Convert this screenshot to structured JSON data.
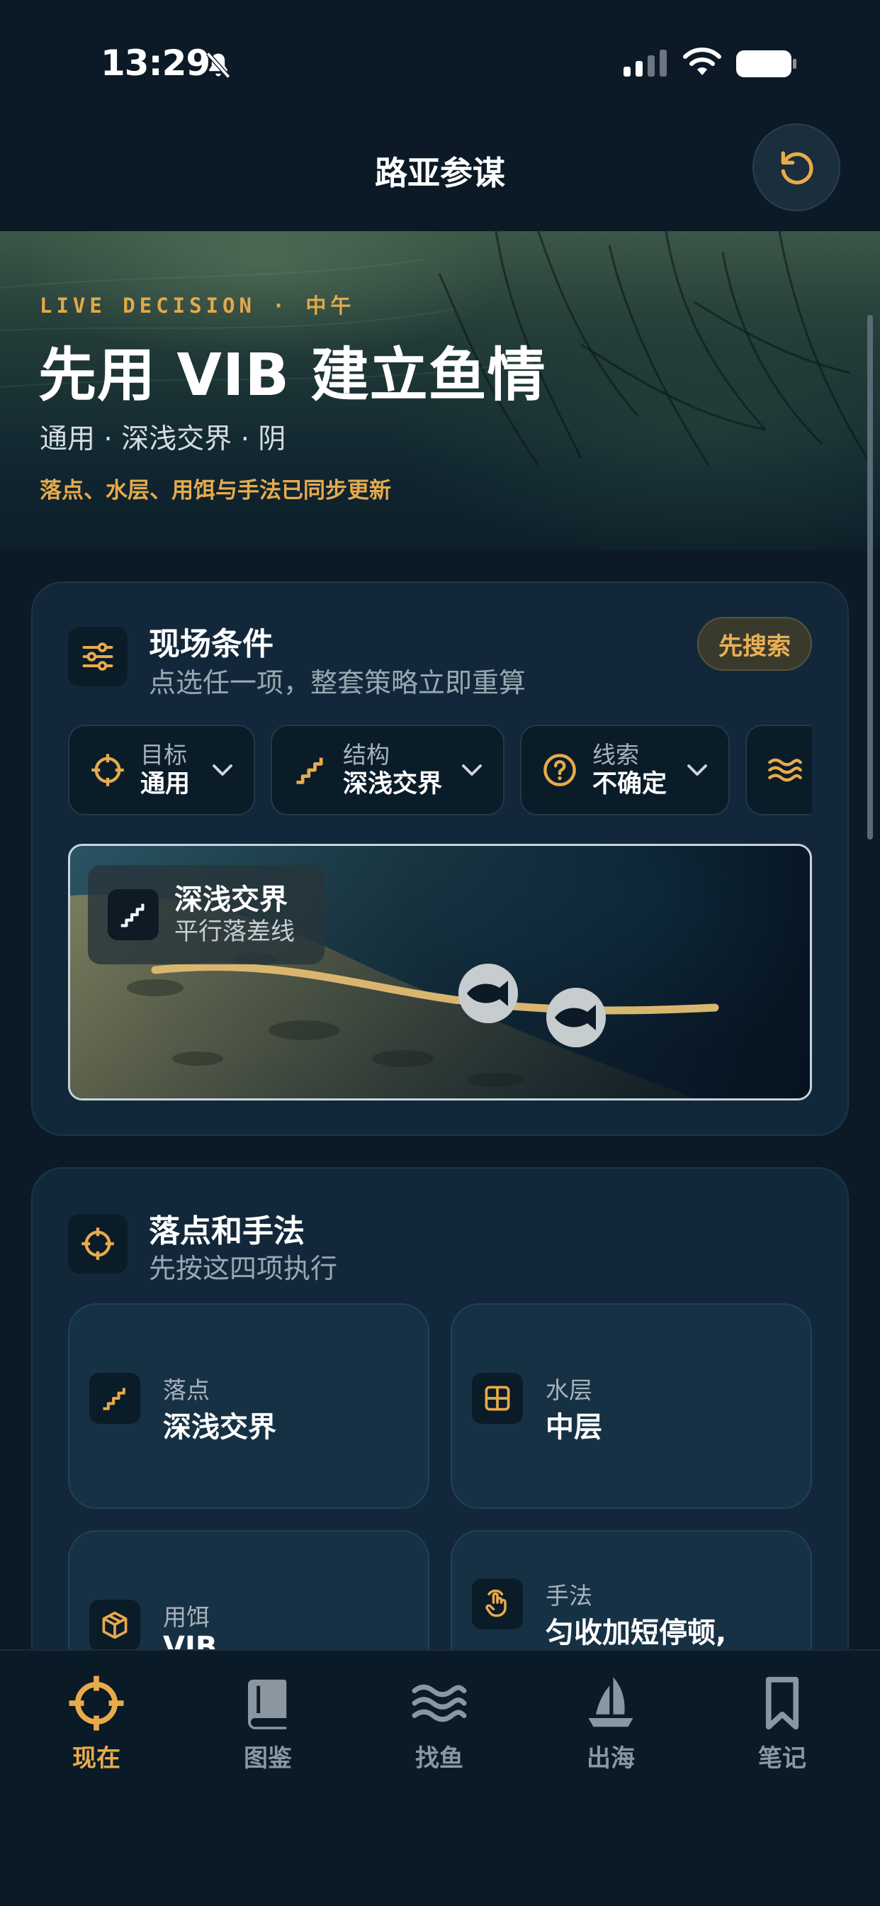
{
  "status": {
    "time": "13:29"
  },
  "header": {
    "title": "路亚参谋"
  },
  "hero": {
    "eyebrow": "LIVE DECISION · 中午",
    "title": "先用 VIB 建立鱼情",
    "subtitle": "通用 · 深浅交界 · 阴",
    "note": "落点、水层、用饵与手法已同步更新"
  },
  "conditions": {
    "title": "现场条件",
    "subtitle": "点选任一项，整套策略立即重算",
    "search_label": "先搜索",
    "chips": [
      {
        "label": "目标",
        "value": "通用",
        "icon": "crosshair-icon"
      },
      {
        "label": "结构",
        "value": "深浅交界",
        "icon": "stairs-icon"
      },
      {
        "label": "线索",
        "value": "不确定",
        "icon": "question-icon"
      },
      {
        "label": "",
        "value": "",
        "icon": "waves-icon"
      }
    ],
    "scene": {
      "title": "深浅交界",
      "subtitle": "平行落差线"
    }
  },
  "plan": {
    "title": "落点和手法",
    "subtitle": "先按这四项执行",
    "steps": [
      {
        "label": "落点",
        "value": "深浅交界",
        "icon": "stairs-icon"
      },
      {
        "label": "水层",
        "value": "中层",
        "icon": "grid-icon"
      },
      {
        "label": "用饵",
        "value": "VIB",
        "icon": "box-icon"
      },
      {
        "label": "手法",
        "value": "匀收加短停顿,",
        "icon": "hand-icon"
      }
    ]
  },
  "tabs": [
    {
      "label": "现在",
      "icon": "crosshair-icon",
      "active": true
    },
    {
      "label": "图鉴",
      "icon": "book-icon",
      "active": false
    },
    {
      "label": "找鱼",
      "icon": "waves-icon",
      "active": false
    },
    {
      "label": "出海",
      "icon": "sailboat-icon",
      "active": false
    },
    {
      "label": "笔记",
      "icon": "bookmark-icon",
      "active": false
    }
  ],
  "colors": {
    "accent": "#e8ab4b",
    "background": "#0b1a26",
    "card": "#12283a",
    "inactive_tab": "#8a97a1"
  }
}
